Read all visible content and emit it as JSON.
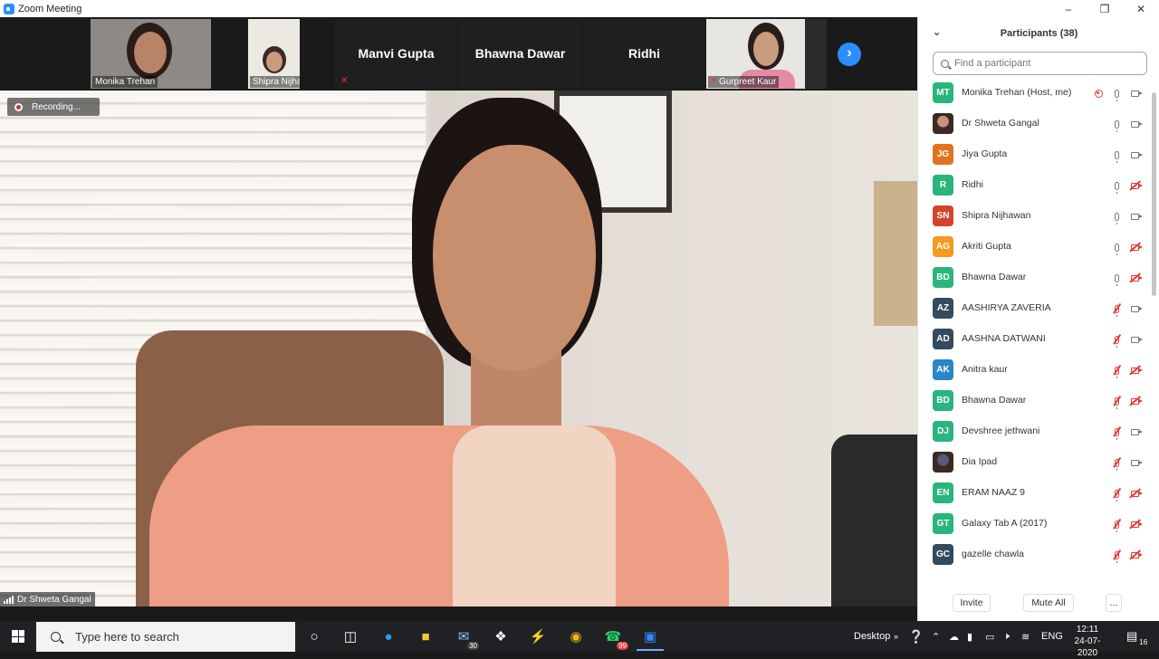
{
  "window": {
    "title": "Zoom Meeting"
  },
  "strip": {
    "tiles": [
      {
        "name": "Monika Trehan",
        "type": "video"
      },
      {
        "name": "Shipra Nijhawan",
        "type": "video"
      },
      {
        "name": "Manvi Gupta",
        "type": "name-only"
      },
      {
        "name": "Bhawna Dawar",
        "type": "name-only"
      },
      {
        "name": "Ridhi",
        "type": "name-only"
      },
      {
        "name": "Gurpreet Kaur",
        "type": "video",
        "muted": true
      }
    ]
  },
  "main": {
    "recording_label": "Recording...",
    "speaker_name": "Dr Shweta Gangal"
  },
  "participants": {
    "header": "Participants (38)",
    "search_placeholder": "Find a participant",
    "list": [
      {
        "initials": "MT",
        "name": "Monika Trehan (Host, me)",
        "color": "#29b57c",
        "mic": "on",
        "cam": "on",
        "recording": true
      },
      {
        "initials": "",
        "name": "Dr Shweta Gangal",
        "color": "#c9907a",
        "mic": "on",
        "cam": "on",
        "photo": true
      },
      {
        "initials": "JG",
        "name": "Jiya Gupta",
        "color": "#e3721e",
        "mic": "on",
        "cam": "on"
      },
      {
        "initials": "R",
        "name": "Ridhi",
        "color": "#29b57c",
        "mic": "on",
        "cam": "off"
      },
      {
        "initials": "SN",
        "name": "Shipra Nijhawan",
        "color": "#d2452c",
        "mic": "on",
        "cam": "on"
      },
      {
        "initials": "AG",
        "name": "Akriti Gupta",
        "color": "#f39a1f",
        "mic": "on",
        "cam": "off"
      },
      {
        "initials": "BD",
        "name": "Bhawna Dawar",
        "color": "#29b57c",
        "mic": "on",
        "cam": "off"
      },
      {
        "initials": "AZ",
        "name": "AASHIRYA ZAVERIA",
        "color": "#344a5e",
        "mic": "off",
        "cam": "on"
      },
      {
        "initials": "AD",
        "name": "AASHNA DATWANI",
        "color": "#344a5e",
        "mic": "off",
        "cam": "on"
      },
      {
        "initials": "AK",
        "name": "Anitra kaur",
        "color": "#2a86c9",
        "mic": "off",
        "cam": "off"
      },
      {
        "initials": "BD",
        "name": "Bhawna Dawar",
        "color": "#29b57c",
        "mic": "off",
        "cam": "off"
      },
      {
        "initials": "DJ",
        "name": "Devshree jethwani",
        "color": "#29b57c",
        "mic": "off",
        "cam": "on"
      },
      {
        "initials": "",
        "name": "Dia Ipad",
        "color": "#5a5a7a",
        "mic": "off",
        "cam": "on",
        "photo": true
      },
      {
        "initials": "EN",
        "name": "ERAM NAAZ 9",
        "color": "#29b57c",
        "mic": "off",
        "cam": "off"
      },
      {
        "initials": "GT",
        "name": "Galaxy Tab A (2017)",
        "color": "#29b57c",
        "mic": "off",
        "cam": "off"
      },
      {
        "initials": "GC",
        "name": "gazelle chawla",
        "color": "#344a5e",
        "mic": "off",
        "cam": "off"
      }
    ],
    "buttons": {
      "invite": "Invite",
      "mute_all": "Mute All",
      "more": "..."
    }
  },
  "taskbar": {
    "search_placeholder": "Type here to search",
    "mail_badge": "30",
    "whatsapp_badge": "99",
    "desktop_label": "Desktop",
    "language": "ENG",
    "time": "12:11",
    "date": "24-07-2020",
    "notifications": "16"
  }
}
